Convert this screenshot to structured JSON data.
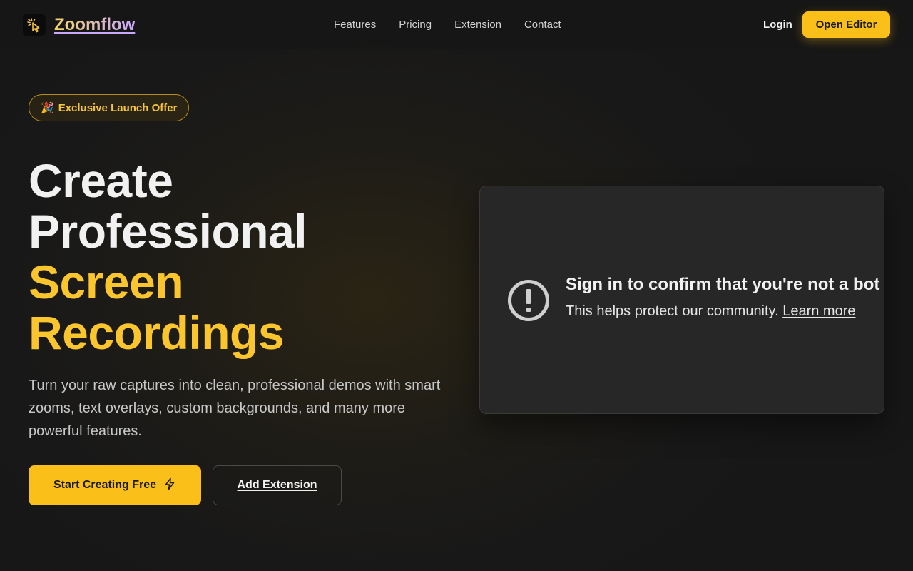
{
  "header": {
    "brand_name": "Zoomflow",
    "nav": [
      "Features",
      "Pricing",
      "Extension",
      "Contact"
    ],
    "login_label": "Login",
    "open_editor_label": "Open Editor"
  },
  "hero": {
    "badge_emoji": "🎉",
    "badge_label": "Exclusive Launch Offer",
    "headline_line1": "Create",
    "headline_line2": "Professional",
    "headline_line3": "Screen",
    "headline_line4": "Recordings",
    "subtext": "Turn your raw captures into clean, professional demos with smart zooms, text overlays, custom backgrounds, and many more powerful features.",
    "primary_button_label": "Start Creating Free",
    "secondary_button_label": "Add Extension"
  },
  "video_embed": {
    "title": "Sign in to confirm that you're not a bot",
    "message": "This helps protect our community.",
    "learn_more_label": "Learn more"
  },
  "colors": {
    "accent": "#fbbf1a",
    "background": "#181818",
    "card": "#272727"
  },
  "icons": {
    "logo": "cursor-click-icon",
    "primary_button": "lightning-icon",
    "video_embed": "exclamation-circle-icon"
  }
}
